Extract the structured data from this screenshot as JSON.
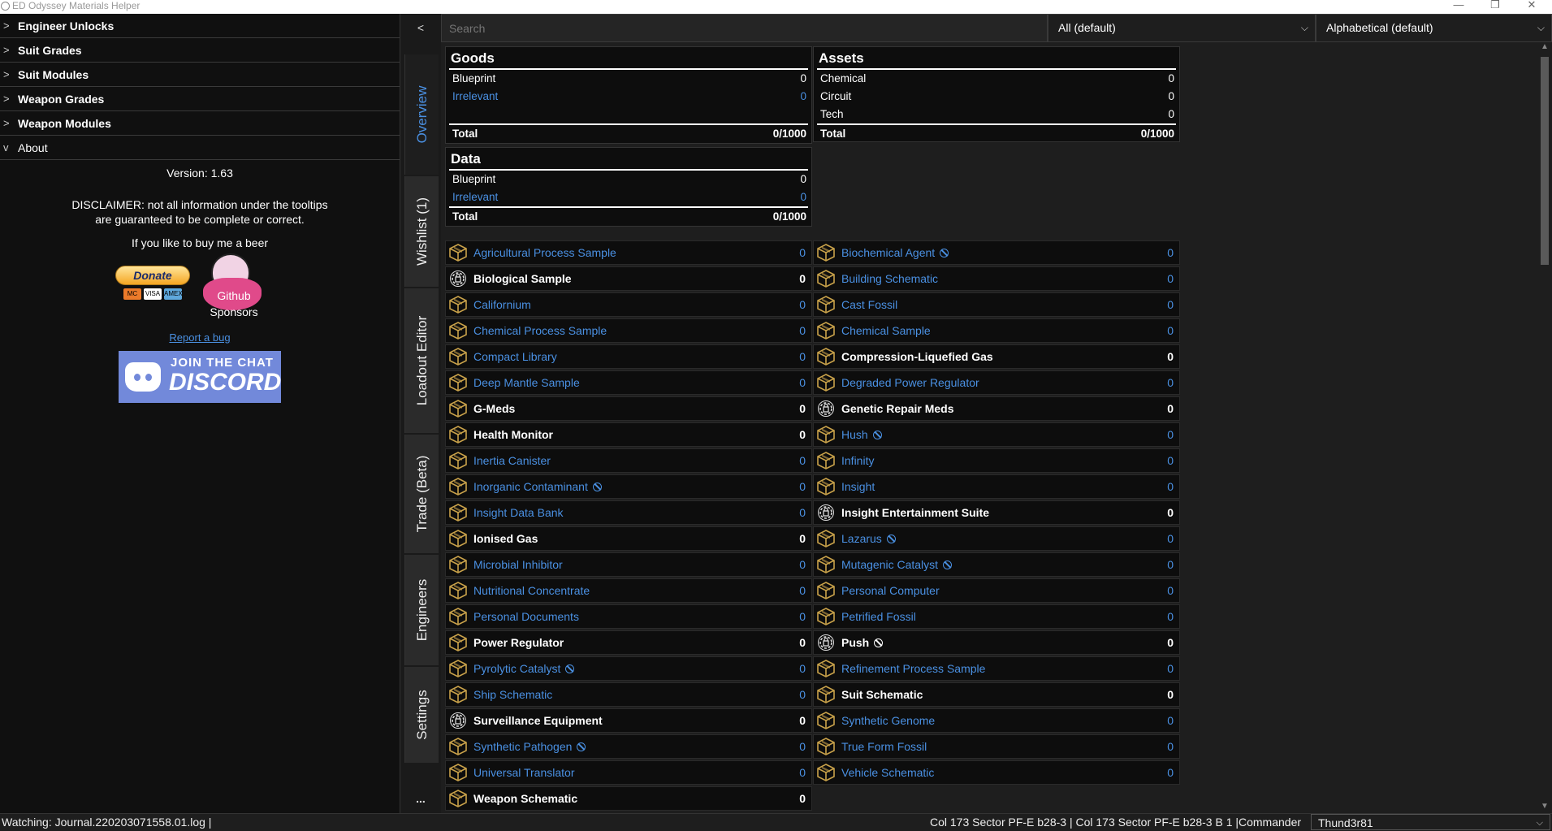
{
  "window": {
    "title": "ED Odyssey Materials Helper",
    "minimize": "—",
    "restore": "❐",
    "close": "✕"
  },
  "sidebar": {
    "items": [
      {
        "label": "Engineer Unlocks",
        "chevron": ">"
      },
      {
        "label": "Suit Grades",
        "chevron": ">"
      },
      {
        "label": "Suit Modules",
        "chevron": ">"
      },
      {
        "label": "Weapon Grades",
        "chevron": ">"
      },
      {
        "label": "Weapon Modules",
        "chevron": ">"
      },
      {
        "label": "About",
        "chevron": "v"
      }
    ],
    "about": {
      "version": "Version: 1.63",
      "disclaimer_1": "DISCLAIMER: not all information under the tooltips",
      "disclaimer_2": "are guaranteed to be complete or correct.",
      "beer": "If you like to buy me a beer",
      "donate": "Donate",
      "cards": [
        "MC",
        "VISA",
        "AMEX"
      ],
      "github_1": "Github",
      "github_2": "Sponsors",
      "report": "Report a bug",
      "discord_1": "JOIN THE CHAT",
      "discord_2": "DISCORD"
    }
  },
  "tabs": {
    "collapse": "<",
    "items": [
      "Overview",
      "Wishlist (1)",
      "Loadout Editor",
      "Trade (Beta)",
      "Engineers",
      "Settings"
    ],
    "active": "Overview",
    "more": "..."
  },
  "toolbar": {
    "search_placeholder": "Search",
    "filter_value": "All (default)",
    "sort_value": "Alphabetical (default)",
    "chevron": "⌵"
  },
  "summary": {
    "goods": {
      "title": "Goods",
      "rows": [
        {
          "label": "Blueprint",
          "value": "0"
        },
        {
          "label": "Irrelevant",
          "value": "0"
        }
      ],
      "total_label": "Total",
      "total_value": "0/1000"
    },
    "assets": {
      "title": "Assets",
      "rows": [
        {
          "label": "Chemical",
          "value": "0"
        },
        {
          "label": "Circuit",
          "value": "0"
        },
        {
          "label": "Tech",
          "value": "0"
        }
      ],
      "total_label": "Total",
      "total_value": "0/1000"
    },
    "data": {
      "title": "Data",
      "rows": [
        {
          "label": "Blueprint",
          "value": "0"
        },
        {
          "label": "Irrelevant",
          "value": "0"
        }
      ],
      "total_label": "Total",
      "total_value": "0/1000"
    }
  },
  "materials_left": [
    {
      "name": "Agricultural Process Sample",
      "value": "0",
      "bold": false,
      "icon": "crate",
      "banned": false
    },
    {
      "name": "Biological Sample",
      "value": "0",
      "bold": true,
      "icon": "gear",
      "banned": false
    },
    {
      "name": "Californium",
      "value": "0",
      "bold": false,
      "icon": "crate",
      "banned": false
    },
    {
      "name": "Chemical Process Sample",
      "value": "0",
      "bold": false,
      "icon": "crate",
      "banned": false
    },
    {
      "name": "Compact Library",
      "value": "0",
      "bold": false,
      "icon": "crate",
      "banned": false
    },
    {
      "name": "Deep Mantle Sample",
      "value": "0",
      "bold": false,
      "icon": "crate",
      "banned": false
    },
    {
      "name": "G-Meds",
      "value": "0",
      "bold": true,
      "icon": "crate",
      "banned": false
    },
    {
      "name": "Health Monitor",
      "value": "0",
      "bold": true,
      "icon": "crate",
      "banned": false
    },
    {
      "name": "Inertia Canister",
      "value": "0",
      "bold": false,
      "icon": "crate",
      "banned": false
    },
    {
      "name": "Inorganic Contaminant",
      "value": "0",
      "bold": false,
      "icon": "crate",
      "banned": true
    },
    {
      "name": "Insight Data Bank",
      "value": "0",
      "bold": false,
      "icon": "crate",
      "banned": false
    },
    {
      "name": "Ionised Gas",
      "value": "0",
      "bold": true,
      "icon": "crate",
      "banned": false
    },
    {
      "name": "Microbial Inhibitor",
      "value": "0",
      "bold": false,
      "icon": "crate",
      "banned": false
    },
    {
      "name": "Nutritional Concentrate",
      "value": "0",
      "bold": false,
      "icon": "crate",
      "banned": false
    },
    {
      "name": "Personal Documents",
      "value": "0",
      "bold": false,
      "icon": "crate",
      "banned": false
    },
    {
      "name": "Power Regulator",
      "value": "0",
      "bold": true,
      "icon": "crate",
      "banned": false
    },
    {
      "name": "Pyrolytic Catalyst",
      "value": "0",
      "bold": false,
      "icon": "crate",
      "banned": true
    },
    {
      "name": "Ship Schematic",
      "value": "0",
      "bold": false,
      "icon": "crate",
      "banned": false
    },
    {
      "name": "Surveillance Equipment",
      "value": "0",
      "bold": true,
      "icon": "gear",
      "banned": false
    },
    {
      "name": "Synthetic Pathogen",
      "value": "0",
      "bold": false,
      "icon": "crate",
      "banned": true
    },
    {
      "name": "Universal Translator",
      "value": "0",
      "bold": false,
      "icon": "crate",
      "banned": false
    },
    {
      "name": "Weapon Schematic",
      "value": "0",
      "bold": true,
      "icon": "crate",
      "banned": false
    }
  ],
  "materials_right": [
    {
      "name": "Biochemical Agent",
      "value": "0",
      "bold": false,
      "icon": "crate",
      "banned": true
    },
    {
      "name": "Building Schematic",
      "value": "0",
      "bold": false,
      "icon": "crate",
      "banned": false
    },
    {
      "name": "Cast Fossil",
      "value": "0",
      "bold": false,
      "icon": "crate",
      "banned": false
    },
    {
      "name": "Chemical Sample",
      "value": "0",
      "bold": false,
      "icon": "crate",
      "banned": false
    },
    {
      "name": "Compression-Liquefied Gas",
      "value": "0",
      "bold": true,
      "icon": "crate",
      "banned": false
    },
    {
      "name": "Degraded Power Regulator",
      "value": "0",
      "bold": false,
      "icon": "crate",
      "banned": false
    },
    {
      "name": "Genetic Repair Meds",
      "value": "0",
      "bold": true,
      "icon": "gear",
      "banned": false
    },
    {
      "name": "Hush",
      "value": "0",
      "bold": false,
      "icon": "crate",
      "banned": true
    },
    {
      "name": "Infinity",
      "value": "0",
      "bold": false,
      "icon": "crate",
      "banned": false
    },
    {
      "name": "Insight",
      "value": "0",
      "bold": false,
      "icon": "crate",
      "banned": false
    },
    {
      "name": "Insight Entertainment Suite",
      "value": "0",
      "bold": true,
      "icon": "gear",
      "banned": false
    },
    {
      "name": "Lazarus",
      "value": "0",
      "bold": false,
      "icon": "crate",
      "banned": true
    },
    {
      "name": "Mutagenic Catalyst",
      "value": "0",
      "bold": false,
      "icon": "crate",
      "banned": true
    },
    {
      "name": "Personal Computer",
      "value": "0",
      "bold": false,
      "icon": "crate",
      "banned": false
    },
    {
      "name": "Petrified Fossil",
      "value": "0",
      "bold": false,
      "icon": "crate",
      "banned": false
    },
    {
      "name": "Push",
      "value": "0",
      "bold": true,
      "icon": "gear",
      "banned": true
    },
    {
      "name": "Refinement Process Sample",
      "value": "0",
      "bold": false,
      "icon": "crate",
      "banned": false
    },
    {
      "name": "Suit Schematic",
      "value": "0",
      "bold": true,
      "icon": "crate",
      "banned": false
    },
    {
      "name": "Synthetic Genome",
      "value": "0",
      "bold": false,
      "icon": "crate",
      "banned": false
    },
    {
      "name": "True Form Fossil",
      "value": "0",
      "bold": false,
      "icon": "crate",
      "banned": false
    },
    {
      "name": "Vehicle Schematic",
      "value": "0",
      "bold": false,
      "icon": "crate",
      "banned": false
    }
  ],
  "status": {
    "watching": "Watching: Journal.220203071558.01.log  |",
    "location": "Col 173 Sector PF-E b28-3 | Col 173 Sector PF-E b28-3 B 1  |",
    "commander_label": "Commander",
    "commander_value": "Thund3r81"
  },
  "colors": {
    "accent": "#4a90e2",
    "icon_gold": "#c9a24a",
    "background": "#1e1e1e"
  }
}
